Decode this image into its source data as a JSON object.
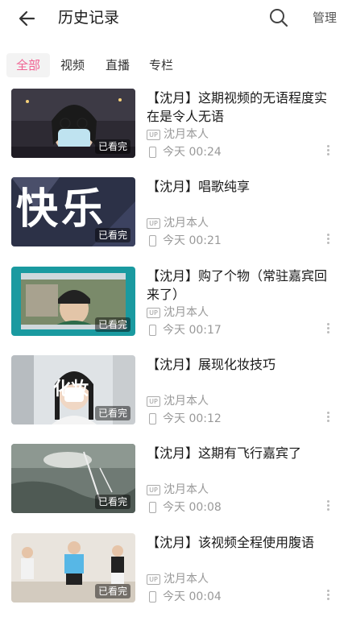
{
  "header": {
    "title": "历史记录",
    "manage_label": "管理"
  },
  "tabs": [
    {
      "label": "全部",
      "active": true
    },
    {
      "label": "视频",
      "active": false
    },
    {
      "label": "直播",
      "active": false
    },
    {
      "label": "专栏",
      "active": false
    }
  ],
  "items": [
    {
      "title": "【沈月】这期视频的无语程度实在是令人无语",
      "up": "沈月本人",
      "time": "今天 00:24",
      "badge": "已看完"
    },
    {
      "title": "【沈月】唱歌纯享",
      "up": "沈月本人",
      "time": "今天 00:21",
      "badge": "已看完",
      "thumb_text": "快乐"
    },
    {
      "title": "【沈月】购了个物（常驻嘉宾回来了）",
      "up": "沈月本人",
      "time": "今天 00:17",
      "badge": "已看完"
    },
    {
      "title": "【沈月】展现化妆技巧",
      "up": "沈月本人",
      "time": "今天 00:12",
      "badge": "已看完",
      "thumb_text": "化妆"
    },
    {
      "title": "【沈月】这期有飞行嘉宾了",
      "up": "沈月本人",
      "time": "今天 00:08",
      "badge": "已看完"
    },
    {
      "title": "【沈月】该视频全程使用腹语",
      "up": "沈月本人",
      "time": "今天 00:04",
      "badge": "已看完"
    }
  ],
  "up_badge_text": "UP",
  "colors": {
    "accent": "#f06292",
    "meta": "#999999"
  }
}
